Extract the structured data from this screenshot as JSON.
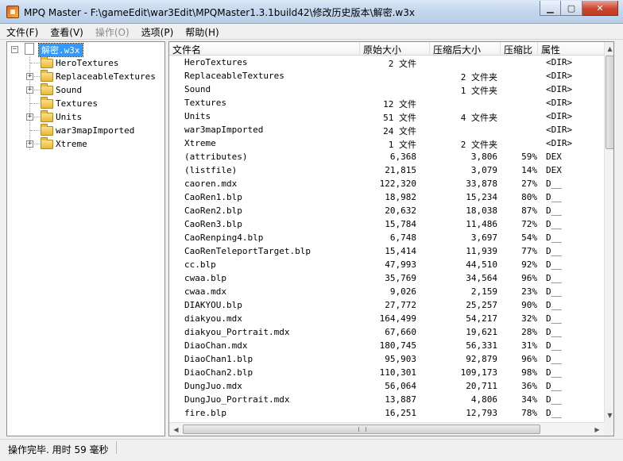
{
  "window": {
    "title": "MPQ Master - F:\\gameEdit\\war3Edit\\MPQMaster1.3.1build42\\修改历史版本\\解密.w3x"
  },
  "menu": {
    "items": [
      {
        "label": "文件(F)",
        "enabled": true
      },
      {
        "label": "查看(V)",
        "enabled": true
      },
      {
        "label": "操作(O)",
        "enabled": false
      },
      {
        "label": "选项(P)",
        "enabled": true
      },
      {
        "label": "帮助(H)",
        "enabled": true
      }
    ]
  },
  "tree": {
    "root": "解密.w3x",
    "children": [
      {
        "label": "HeroTextures",
        "expandable": false
      },
      {
        "label": "ReplaceableTextures",
        "expandable": true
      },
      {
        "label": "Sound",
        "expandable": true
      },
      {
        "label": "Textures",
        "expandable": false
      },
      {
        "label": "Units",
        "expandable": true
      },
      {
        "label": "war3mapImported",
        "expandable": false
      },
      {
        "label": "Xtreme",
        "expandable": true
      }
    ]
  },
  "list": {
    "columns": [
      "文件名",
      "原始大小",
      "压缩后大小",
      "压缩比",
      "属性"
    ],
    "rows": [
      {
        "name": "HeroTextures",
        "orig": "2 文件",
        "comp": "",
        "ratio": "",
        "attr": "<DIR>"
      },
      {
        "name": "ReplaceableTextures",
        "orig": "",
        "comp": "2 文件夹",
        "ratio": "",
        "attr": "<DIR>"
      },
      {
        "name": "Sound",
        "orig": "",
        "comp": "1 文件夹",
        "ratio": "",
        "attr": "<DIR>"
      },
      {
        "name": "Textures",
        "orig": "12 文件",
        "comp": "",
        "ratio": "",
        "attr": "<DIR>"
      },
      {
        "name": "Units",
        "orig": "51 文件",
        "comp": "4 文件夹",
        "ratio": "",
        "attr": "<DIR>"
      },
      {
        "name": "war3mapImported",
        "orig": "24 文件",
        "comp": "",
        "ratio": "",
        "attr": "<DIR>"
      },
      {
        "name": "Xtreme",
        "orig": "1 文件",
        "comp": "2 文件夹",
        "ratio": "",
        "attr": "<DIR>"
      },
      {
        "name": "(attributes)",
        "orig": "6,368",
        "comp": "3,806",
        "ratio": "59%",
        "attr": "DEX"
      },
      {
        "name": "(listfile)",
        "orig": "21,815",
        "comp": "3,079",
        "ratio": "14%",
        "attr": "DEX"
      },
      {
        "name": "caoren.mdx",
        "orig": "122,320",
        "comp": "33,878",
        "ratio": "27%",
        "attr": "D__"
      },
      {
        "name": "CaoRen1.blp",
        "orig": "18,982",
        "comp": "15,234",
        "ratio": "80%",
        "attr": "D__"
      },
      {
        "name": "CaoRen2.blp",
        "orig": "20,632",
        "comp": "18,038",
        "ratio": "87%",
        "attr": "D__"
      },
      {
        "name": "CaoRen3.blp",
        "orig": "15,784",
        "comp": "11,486",
        "ratio": "72%",
        "attr": "D__"
      },
      {
        "name": "CaoRenping4.blp",
        "orig": "6,748",
        "comp": "3,697",
        "ratio": "54%",
        "attr": "D__"
      },
      {
        "name": "CaoRenTeleportTarget.blp",
        "orig": "15,414",
        "comp": "11,939",
        "ratio": "77%",
        "attr": "D__"
      },
      {
        "name": "cc.blp",
        "orig": "47,993",
        "comp": "44,510",
        "ratio": "92%",
        "attr": "D__"
      },
      {
        "name": "cwaa.blp",
        "orig": "35,769",
        "comp": "34,564",
        "ratio": "96%",
        "attr": "D__"
      },
      {
        "name": "cwaa.mdx",
        "orig": "9,026",
        "comp": "2,159",
        "ratio": "23%",
        "attr": "D__"
      },
      {
        "name": "DIAKYOU.blp",
        "orig": "27,772",
        "comp": "25,257",
        "ratio": "90%",
        "attr": "D__"
      },
      {
        "name": "diakyou.mdx",
        "orig": "164,499",
        "comp": "54,217",
        "ratio": "32%",
        "attr": "D__"
      },
      {
        "name": "diakyou_Portrait.mdx",
        "orig": "67,660",
        "comp": "19,621",
        "ratio": "28%",
        "attr": "D__"
      },
      {
        "name": "DiaoChan.mdx",
        "orig": "180,745",
        "comp": "56,331",
        "ratio": "31%",
        "attr": "D__"
      },
      {
        "name": "DiaoChan1.blp",
        "orig": "95,903",
        "comp": "92,879",
        "ratio": "96%",
        "attr": "D__"
      },
      {
        "name": "DiaoChan2.blp",
        "orig": "110,301",
        "comp": "109,173",
        "ratio": "98%",
        "attr": "D__"
      },
      {
        "name": "DungJuo.mdx",
        "orig": "56,064",
        "comp": "20,711",
        "ratio": "36%",
        "attr": "D__"
      },
      {
        "name": "DungJuo_Portrait.mdx",
        "orig": "13,887",
        "comp": "4,806",
        "ratio": "34%",
        "attr": "D__"
      },
      {
        "name": "fire.blp",
        "orig": "16,251",
        "comp": "12,793",
        "ratio": "78%",
        "attr": "D__"
      }
    ]
  },
  "status": {
    "text": "操作完毕. 用时 59 毫秒"
  }
}
